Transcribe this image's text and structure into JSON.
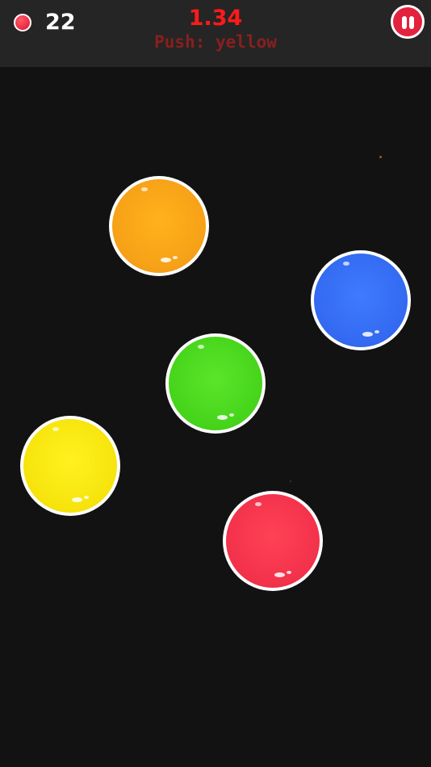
{
  "hud": {
    "lives_icon": "red-ball-icon",
    "lives_count": "22",
    "timer": "1.34",
    "instruction": "Push: yellow",
    "pause_icon": "pause-icon"
  },
  "balls": [
    {
      "color_name": "orange",
      "color": "#f6a018"
    },
    {
      "color_name": "blue",
      "color": "#3269f0"
    },
    {
      "color_name": "green",
      "color": "#45d41a"
    },
    {
      "color_name": "yellow",
      "color": "#f6e30c"
    },
    {
      "color_name": "red",
      "color": "#f2314a"
    }
  ],
  "colors": {
    "background": "#121212",
    "topbar": "#252525",
    "timer": "#ff1a1a",
    "instruction": "#8a1f1f",
    "pause_button": "#e3223e"
  }
}
